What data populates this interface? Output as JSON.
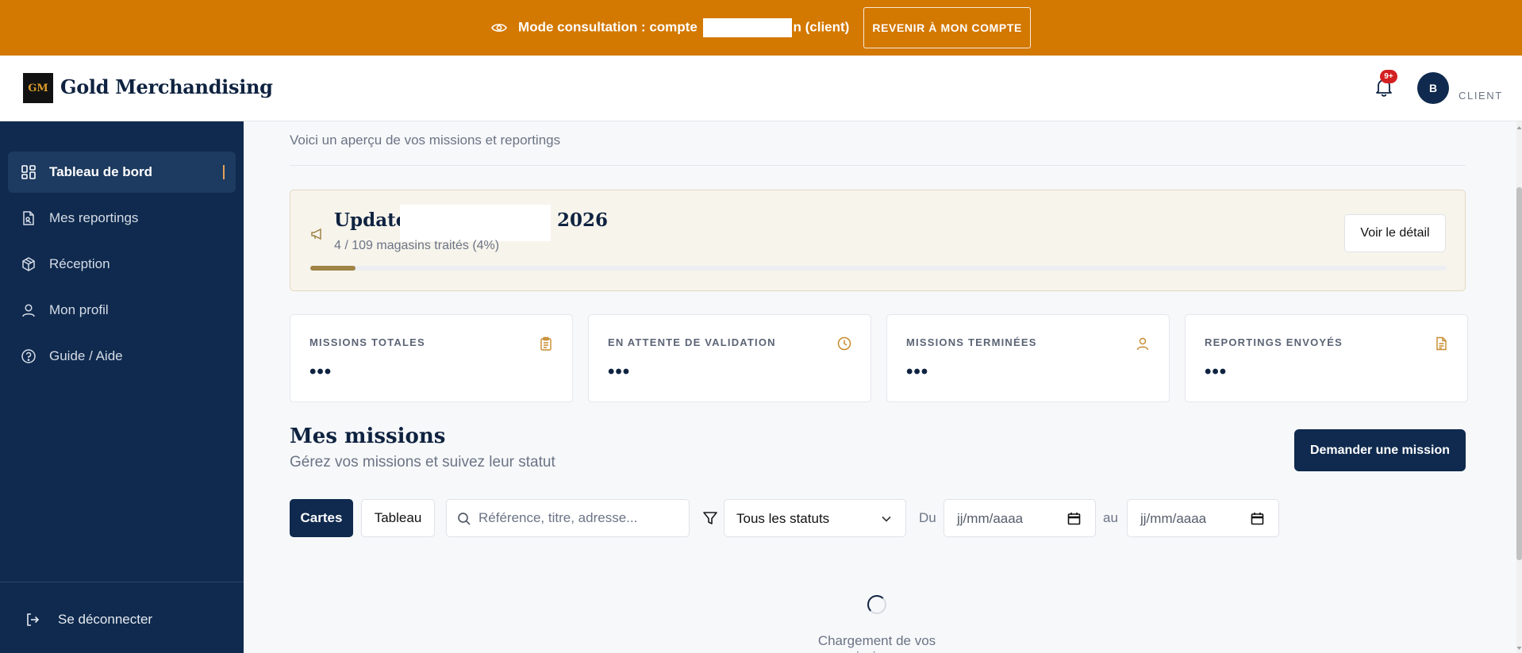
{
  "banner": {
    "prefix": "Mode consultation : compte",
    "suffix": "n (client)",
    "back_label": "REVENIR À MON COMPTE"
  },
  "header": {
    "logo_mark": "GM",
    "brand": "Gold Merchandising",
    "notifications_badge": "9+",
    "avatar_initial": "B",
    "role": "CLIENT"
  },
  "sidebar": {
    "items": [
      {
        "label": "Tableau de bord",
        "icon": "dashboard-icon"
      },
      {
        "label": "Mes reportings",
        "icon": "report-icon"
      },
      {
        "label": "Réception",
        "icon": "package-icon"
      },
      {
        "label": "Mon profil",
        "icon": "user-icon"
      },
      {
        "label": "Guide / Aide",
        "icon": "help-icon"
      }
    ],
    "logout_label": "Se déconnecter"
  },
  "main": {
    "subtitle": "Voici un aperçu de vos missions et reportings",
    "update": {
      "title_start": "Update",
      "title_end": "2026",
      "progress_text": "4 / 109 magasins traités (4%)",
      "progress_percent": 4,
      "detail_label": "Voir le détail"
    },
    "stats": [
      {
        "label": "MISSIONS TOTALES",
        "value": "•••",
        "icon": "clipboard-icon"
      },
      {
        "label": "EN ATTENTE DE VALIDATION",
        "value": "•••",
        "icon": "clock-icon"
      },
      {
        "label": "MISSIONS TERMINÉES",
        "value": "•••",
        "icon": "user-icon"
      },
      {
        "label": "REPORTINGS ENVOYÉS",
        "value": "•••",
        "icon": "document-icon"
      }
    ],
    "missions": {
      "title": "Mes missions",
      "subtitle": "Gérez vos missions et suivez leur statut",
      "request_label": "Demander une mission",
      "view_cards": "Cartes",
      "view_table": "Tableau",
      "search_placeholder": "Référence, titre, adresse...",
      "status_value": "Tous les statuts",
      "from_label": "Du",
      "to_label": "au",
      "date_placeholder": "jj/mm/aaaa",
      "loading_text": "Chargement de vos missions..."
    }
  },
  "colors": {
    "banner": "#d37800",
    "navy": "#0f2a4e",
    "gold": "#a08346",
    "accent": "#d99a2b"
  }
}
